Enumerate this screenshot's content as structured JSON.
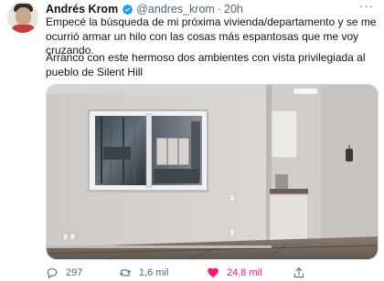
{
  "tweet": {
    "author": "Andrés Krom",
    "handle": "@andres_krom",
    "separator": "·",
    "time": "20h",
    "text_1": "Empecé la búsqueda de mi próxima vivienda/departamento y se me ocurrió armar un hilo con las cosas más espantosas que me voy cruzando.",
    "text_2": "Arranco con este hermoso dos ambientes con vista privilegiada al pueblo de Silent Hill",
    "icons": {
      "verified": "verified-badge-icon",
      "more": "more-options-icon",
      "reply": "reply-icon",
      "retweet": "retweet-icon",
      "like": "heart-icon",
      "share": "share-icon"
    },
    "actions": {
      "replies": "297",
      "retweets": "1,6 mil",
      "likes": "24,8 mil"
    },
    "liked": true,
    "colors": {
      "verified": "#1d9bf0",
      "liked": "#f91880",
      "secondary_text": "#536471"
    }
  }
}
